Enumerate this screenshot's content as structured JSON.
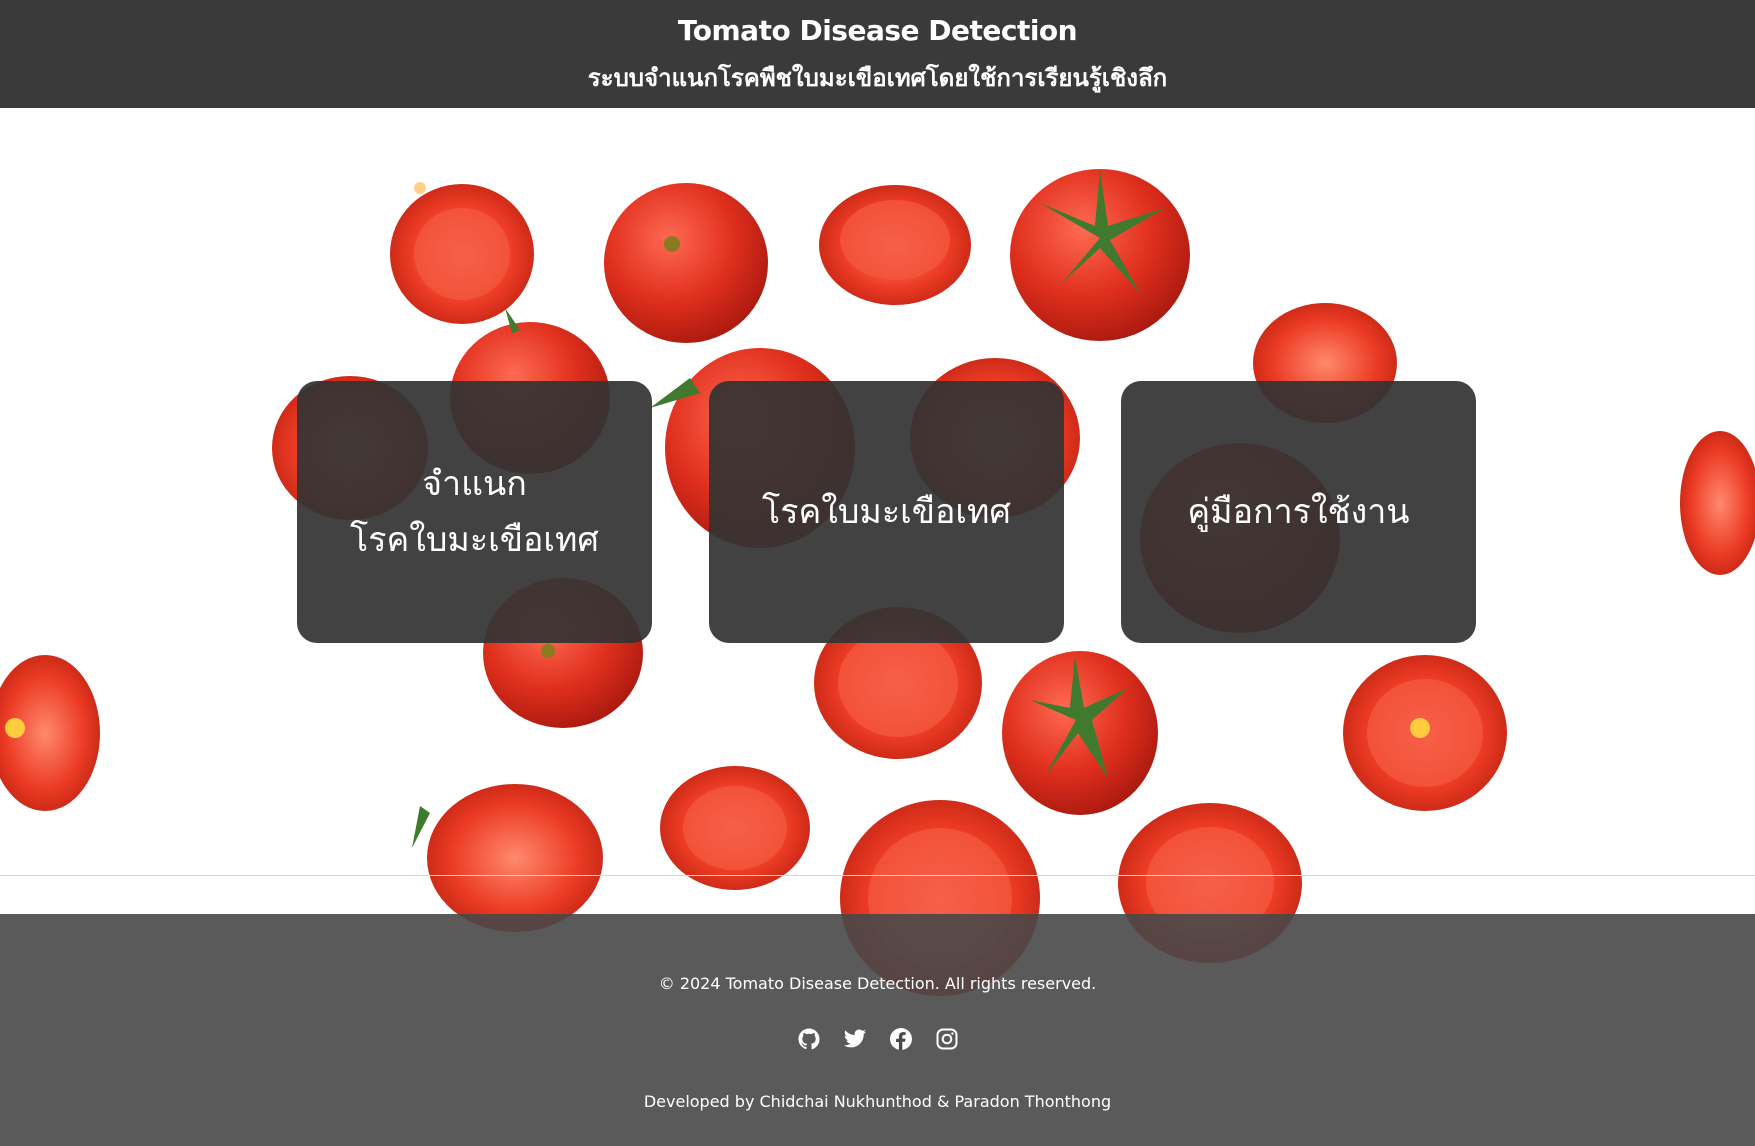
{
  "header": {
    "title": "Tomato Disease Detection",
    "subtitle": "ระบบจำแนกโรคพืชใบมะเขือเทศโดยใช้การเรียนรู้เชิงลึก"
  },
  "cards": [
    {
      "line1": "จำแนก",
      "line2": "โรคใบมะเขือเทศ"
    },
    {
      "line1": "โรคใบมะเขือเทศ"
    },
    {
      "line1": "คู่มือการใช้งาน"
    }
  ],
  "footer": {
    "copyright": "© 2024 Tomato Disease Detection. All rights reserved.",
    "socials": [
      "github-icon",
      "twitter-icon",
      "facebook-icon",
      "instagram-icon"
    ],
    "developer": "Developed by Chidchai Nukhunthod & Paradon Thonthong"
  },
  "colors": {
    "header_bg": "#3a3a3a",
    "card_bg": "#343434",
    "footer_bg": "#484848",
    "tomato_red": "#e0301e",
    "stem_green": "#3f7a2e"
  }
}
